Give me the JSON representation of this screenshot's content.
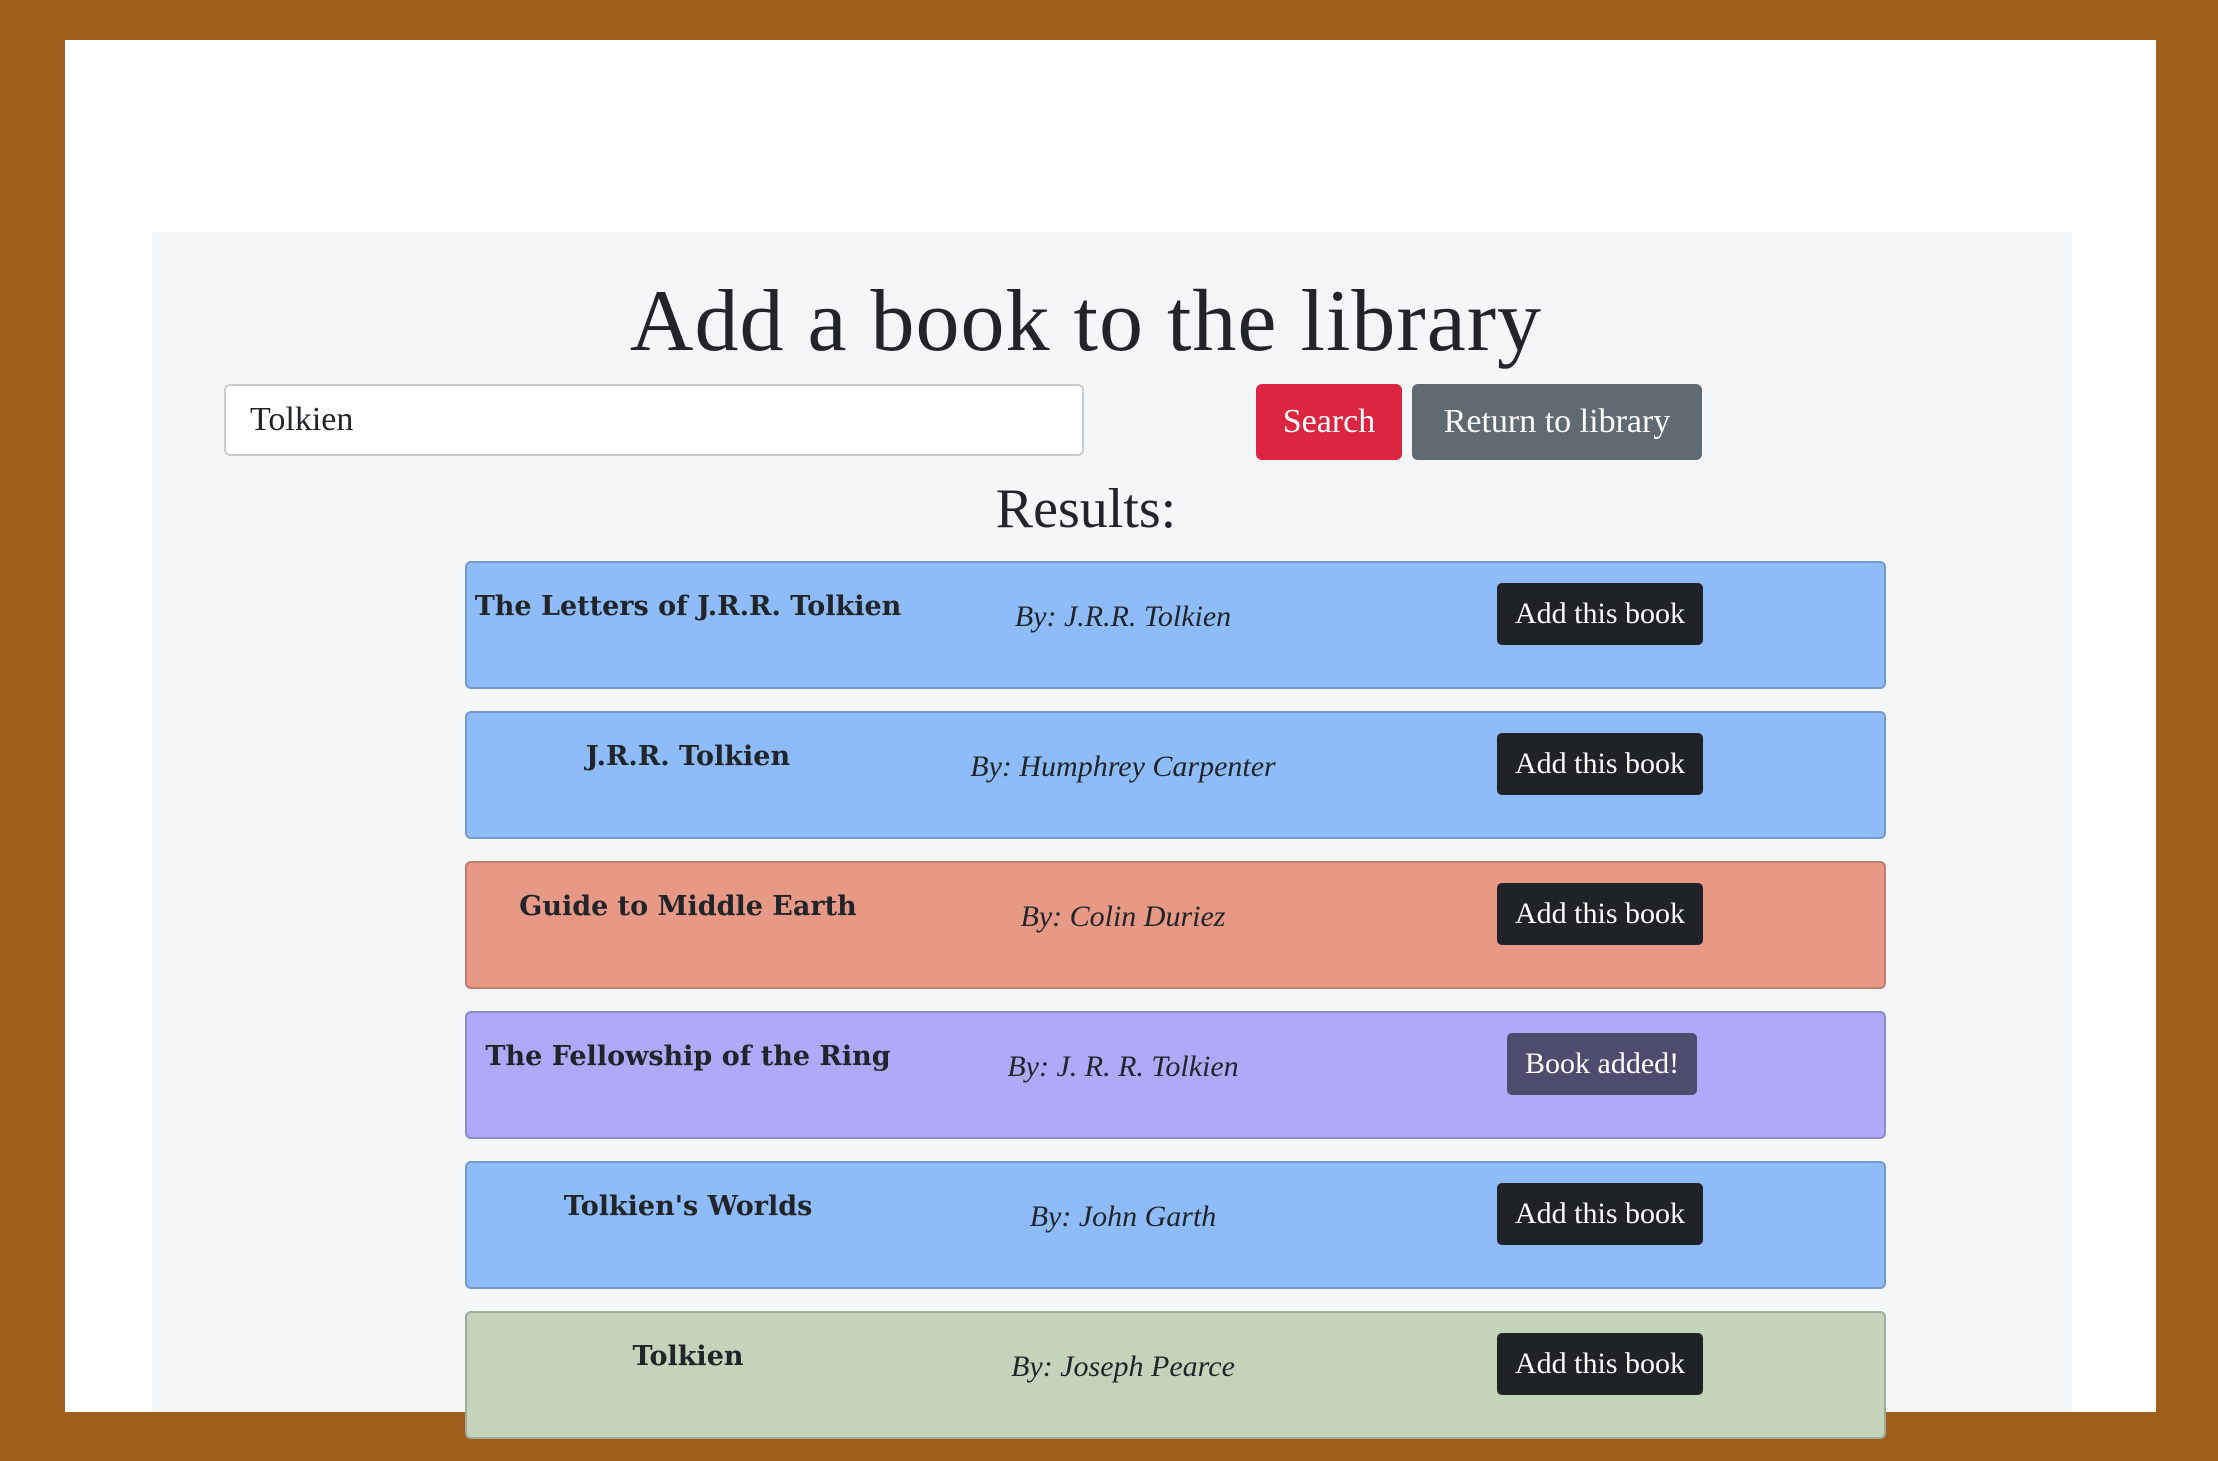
{
  "page_title": "Add a book to the library",
  "search": {
    "value": "Tolkien",
    "button_label": "Search"
  },
  "return_button_label": "Return to library",
  "results_heading": "Results:",
  "results": [
    {
      "title": "The Letters of J.R.R. Tolkien",
      "author": "By: J.R.R. Tolkien",
      "button_label": "Add this book",
      "color": "#8ebcf8",
      "added": false
    },
    {
      "title": "J.R.R. Tolkien",
      "author": "By: Humphrey Carpenter",
      "button_label": "Add this book",
      "color": "#8ebcf8",
      "added": false
    },
    {
      "title": "Guide to Middle Earth",
      "author": "By: Colin Duriez",
      "button_label": "Add this book",
      "color": "#e89985",
      "added": false
    },
    {
      "title": "The Fellowship of the Ring",
      "author": "By: J. R. R. Tolkien",
      "button_label": "Book added!",
      "color": "#b0a8f8",
      "added": true
    },
    {
      "title": "Tolkien's Worlds",
      "author": "By: John Garth",
      "button_label": "Add this book",
      "color": "#8ebcf8",
      "added": false
    },
    {
      "title": "Tolkien",
      "author": "By: Joseph Pearce",
      "button_label": "Add this book",
      "color": "#c3d4ba",
      "added": false
    }
  ],
  "colors": {
    "background": "#9e5e1c",
    "search_button": "#dc2641",
    "return_button": "#5f6a72",
    "add_button": "#1f2226",
    "added_button": "#4e4c6e"
  }
}
